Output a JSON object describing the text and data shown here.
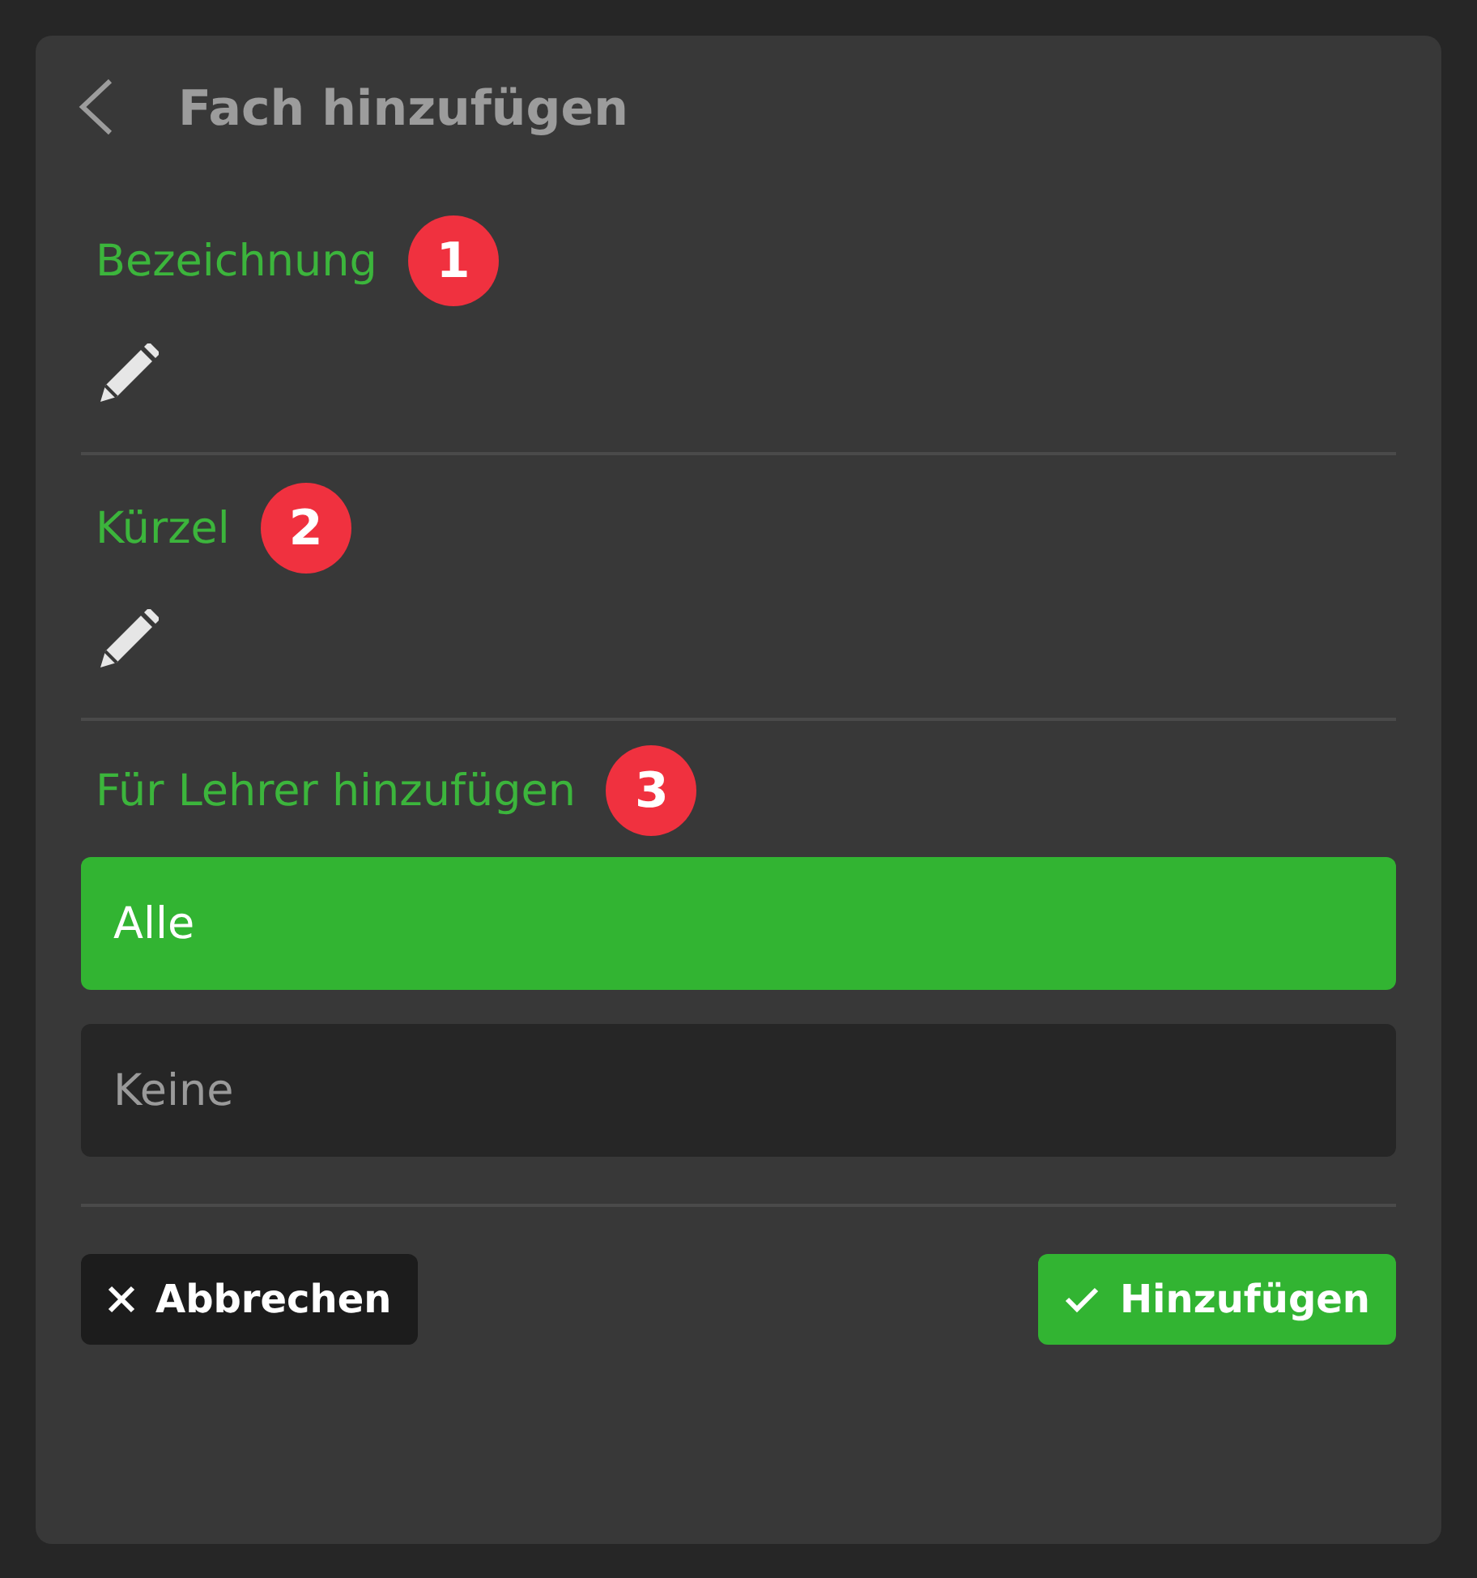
{
  "header": {
    "title": "Fach hinzufügen"
  },
  "fields": [
    {
      "label": "Bezeichnung",
      "badge": "1",
      "kind": "text"
    },
    {
      "label": "Kürzel",
      "badge": "2",
      "kind": "text"
    }
  ],
  "teachers": {
    "label": "Für Lehrer hinzufügen",
    "badge": "3",
    "options": [
      {
        "label": "Alle",
        "selected": true
      },
      {
        "label": "Keine",
        "selected": false
      }
    ]
  },
  "buttons": [
    {
      "label": "Abbrechen",
      "kind": "cancel"
    },
    {
      "label": "Hinzufügen",
      "kind": "confirm"
    }
  ]
}
